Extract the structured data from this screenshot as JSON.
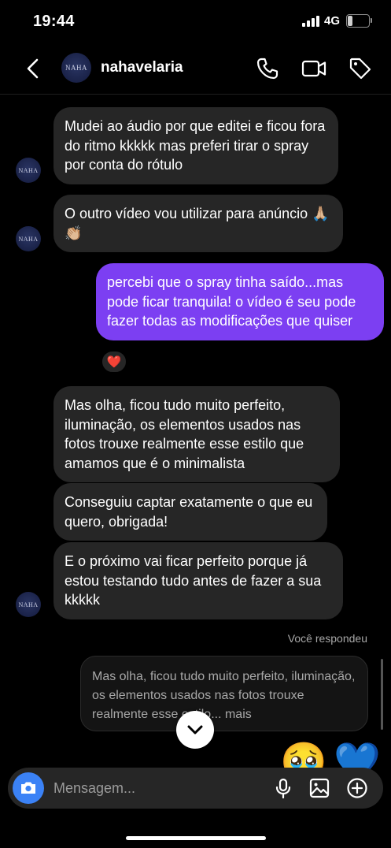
{
  "status": {
    "time": "19:44",
    "network": "4G",
    "battery_level": "5",
    "battery_fraction": 0.2
  },
  "header": {
    "contact_name": "nahavelaria",
    "avatar_text": "NAHA"
  },
  "messages": [
    {
      "text": "Mudei ao áudio por que editei e ficou fora do ritmo kkkkk mas preferi tirar o spray por conta do rótulo"
    },
    {
      "text": "O outro vídeo vou utilizar para anúncio 🙏🏼👏🏼"
    },
    {
      "text": "percebi que o spray tinha saído...mas pode ficar tranquila! o vídeo é seu pode fazer todas as modificações que quiser",
      "reaction": "❤️"
    },
    {
      "text": "Mas olha, ficou tudo muito perfeito, iluminação, os elementos usados nas fotos trouxe realmente esse estilo que amamos que é o minimalista"
    },
    {
      "text": "Conseguiu captar exatamente o que eu quero, obrigada!"
    },
    {
      "text": "E o próximo vai ficar perfeito porque já estou testando tudo antes  de  fazer a sua kkkkk"
    }
  ],
  "reply": {
    "label": "Você respondeu",
    "quoted": "Mas olha, ficou tudo muito perfeito, iluminação, os elementos usados nas fotos trouxe realmente esse estilo... mais"
  },
  "peek_emojis": [
    "🥹",
    "💙"
  ],
  "composer": {
    "placeholder": "Mensagem..."
  },
  "colors": {
    "outgoing_bubble": "#7c3ff2",
    "incoming_bubble": "#262626",
    "camera_button": "#3b82f6"
  },
  "icons": [
    "back-arrow-icon",
    "phone-icon",
    "video-camera-icon",
    "tag-icon",
    "chevron-down-icon",
    "camera-icon",
    "microphone-icon",
    "gallery-icon",
    "plus-circle-icon"
  ]
}
